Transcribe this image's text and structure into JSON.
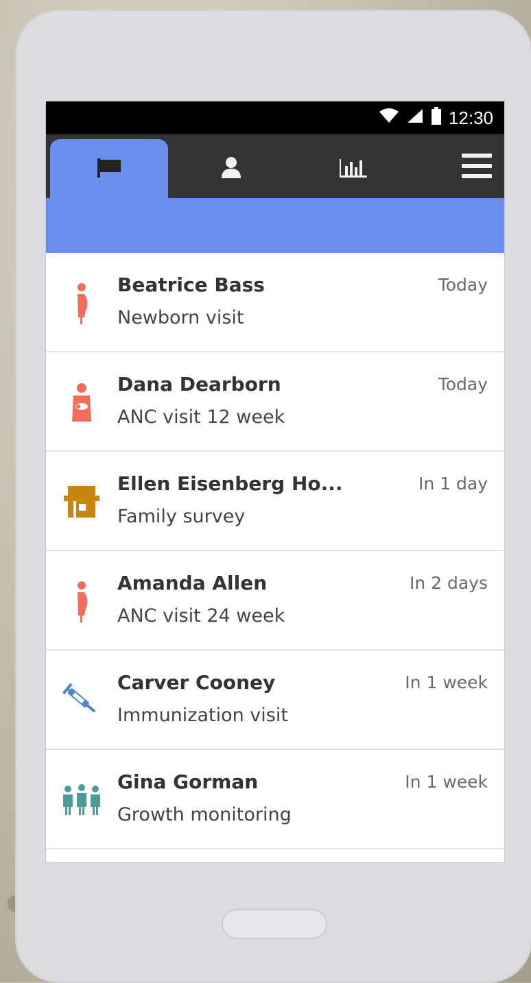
{
  "colors": {
    "accent": "#6b8ff0",
    "tabbar": "#333333",
    "person_icon": "#f26d5b",
    "house_icon": "#c8860d",
    "immunization_icon": "#4a87c7",
    "group_icon": "#4e9a9a"
  },
  "status_bar": {
    "time": "12:30",
    "icons": [
      "wifi-icon",
      "signal-icon",
      "battery-icon"
    ]
  },
  "tabs": [
    {
      "icon": "flag-icon",
      "active": true
    },
    {
      "icon": "person-icon",
      "active": false
    },
    {
      "icon": "analytics-icon",
      "active": false
    }
  ],
  "menu": {
    "icon": "hamburger-menu-icon"
  },
  "tasks": [
    {
      "name": "Beatrice Bass",
      "task": "Newborn visit",
      "due": "Today",
      "icon": "pregnant-woman-icon"
    },
    {
      "name": "Dana Dearborn",
      "task": "ANC visit 12 week",
      "due": "Today",
      "icon": "mother-baby-icon"
    },
    {
      "name": "Ellen Eisenberg Ho...",
      "task": "Family survey",
      "due": "In 1 day",
      "icon": "household-icon"
    },
    {
      "name": "Amanda Allen",
      "task": "ANC visit 24 week",
      "due": "In 2 days",
      "icon": "pregnant-woman-icon"
    },
    {
      "name": "Carver Cooney",
      "task": "Immunization visit",
      "due": "In 1 week",
      "icon": "syringe-icon"
    },
    {
      "name": "Gina Gorman",
      "task": "Growth monitoring",
      "due": "In 1 week",
      "icon": "family-group-icon"
    }
  ]
}
